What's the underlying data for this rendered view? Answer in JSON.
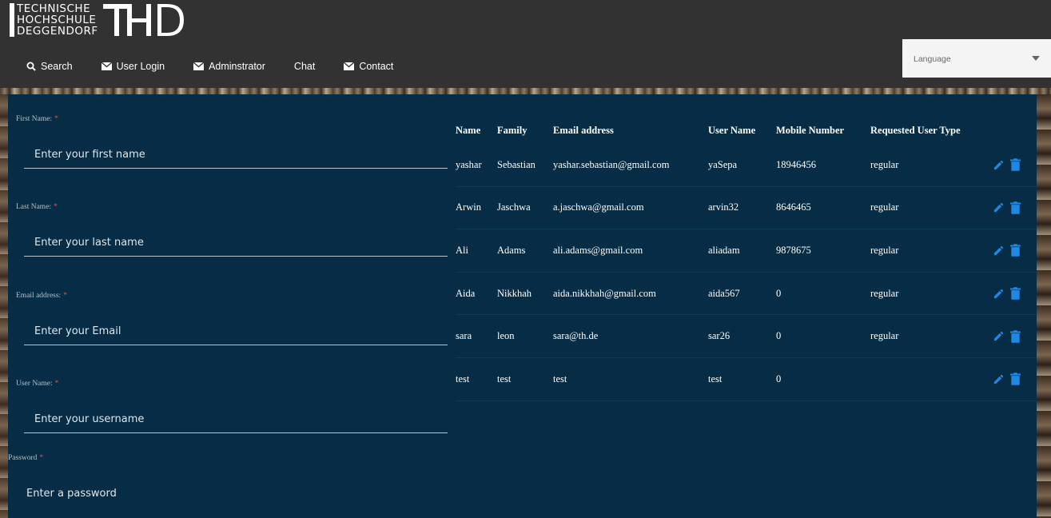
{
  "logo": {
    "lines": [
      "TECHNISCHE",
      "HOCHSCHULE",
      "DEGGENDORF"
    ],
    "mark": "THD"
  },
  "nav": [
    {
      "label": "Search",
      "icon": "search-icon"
    },
    {
      "label": "User Login",
      "icon": "envelope-icon"
    },
    {
      "label": "Adminstrator",
      "icon": "envelope-icon"
    },
    {
      "label": "Chat",
      "icon": ""
    },
    {
      "label": "Contact",
      "icon": "envelope-icon"
    }
  ],
  "language": {
    "label": "Language"
  },
  "form": {
    "fields": [
      {
        "label": "First Name:",
        "placeholder": "Enter your first name"
      },
      {
        "label": "Last Name:",
        "placeholder": "Enter your last name"
      },
      {
        "label": "Email address:",
        "placeholder": "Enter your Email"
      },
      {
        "label": "User Name:",
        "placeholder": "Enter your username"
      },
      {
        "label": "Password",
        "placeholder": "Enter a password"
      }
    ],
    "required_mark": "*"
  },
  "table": {
    "headers": [
      "Name",
      "Family",
      "Email address",
      "User Name",
      "Mobile Number",
      "Requested User Type"
    ],
    "rows": [
      [
        "yashar",
        "Sebastian",
        "yashar.sebastian@gmail.com",
        "yaSepa",
        "18946456",
        "regular"
      ],
      [
        "Arwin",
        "Jaschwa",
        "a.jaschwa@gmail.com",
        "arvin32",
        "8646465",
        "regular"
      ],
      [
        "Ali",
        "Adams",
        "ali.adams@gmail.com",
        "aliadam",
        "9878675",
        "regular"
      ],
      [
        "Aida",
        "Nikkhah",
        "aida.nikkhah@gmail.com",
        "aida567",
        "0",
        "regular"
      ],
      [
        "sara",
        "leon",
        "sara@th.de",
        "sar26",
        "0",
        "regular"
      ],
      [
        "test",
        "test",
        "test",
        "test",
        "0",
        ""
      ]
    ]
  },
  "colors": {
    "header_bg": "#323232",
    "panel_bg": "#062d45",
    "action_blue": "#1e88e5",
    "required_red": "#e05050"
  }
}
